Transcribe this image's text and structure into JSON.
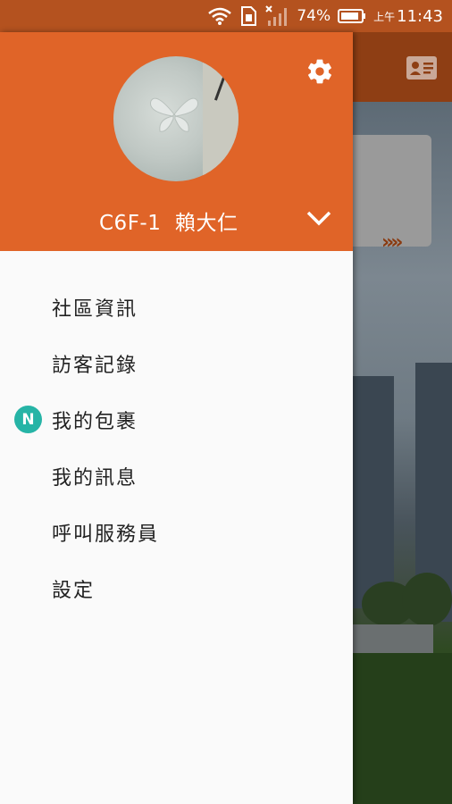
{
  "status_bar": {
    "battery": "74%",
    "ampm": "上午",
    "time": "11:43",
    "icons": [
      "wifi-icon",
      "sim-icon",
      "signal-icon",
      "battery-icon"
    ]
  },
  "drawer": {
    "header_color": "#e06428",
    "user": {
      "unit": "C6F-1",
      "name": "賴大仁"
    },
    "menu": [
      {
        "label": "社區資訊",
        "badge": ""
      },
      {
        "label": "訪客記錄",
        "badge": ""
      },
      {
        "label": "我的包裹",
        "badge": "N"
      },
      {
        "label": "我的訊息",
        "badge": ""
      },
      {
        "label": "呼叫服務員",
        "badge": ""
      },
      {
        "label": "設定",
        "badge": ""
      }
    ]
  },
  "background_app": {
    "header_color": "#8e3e14",
    "card_arrows": "»»"
  }
}
